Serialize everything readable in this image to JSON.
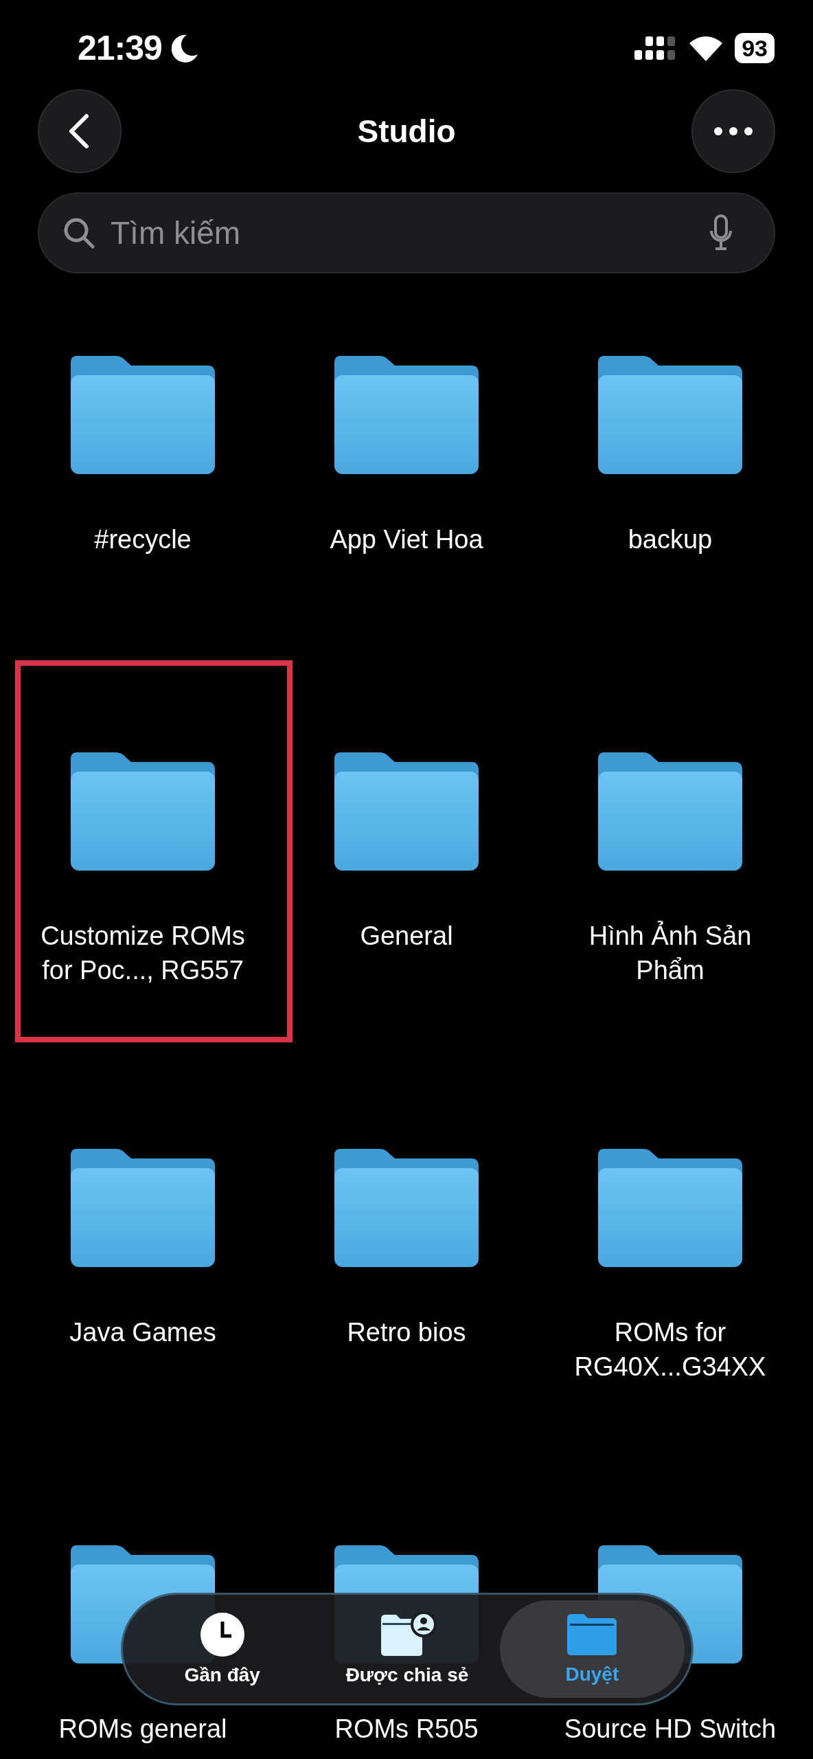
{
  "status_bar": {
    "time": "21:39",
    "battery": "93"
  },
  "header": {
    "title": "Studio"
  },
  "search": {
    "placeholder": "Tìm kiếm"
  },
  "folders": [
    {
      "name": "#recycle",
      "highlighted": false
    },
    {
      "name": "App Viet Hoa",
      "highlighted": false
    },
    {
      "name": "backup",
      "highlighted": false
    },
    {
      "name": "Customize ROMs for Poc..., RG557",
      "highlighted": true
    },
    {
      "name": "General",
      "highlighted": false
    },
    {
      "name": "Hình Ảnh Sản Phẩm",
      "highlighted": false
    },
    {
      "name": "Java Games",
      "highlighted": false
    },
    {
      "name": "Retro bios",
      "highlighted": false
    },
    {
      "name": "ROMs for RG40X...G34XX",
      "highlighted": false
    },
    {
      "name": "ROMs general",
      "highlighted": false
    },
    {
      "name": "ROMs R505",
      "highlighted": false
    },
    {
      "name": "Source HD Switch",
      "highlighted": false
    }
  ],
  "tab_bar": [
    {
      "label": "Gần đây",
      "kind": "recent",
      "selected": false
    },
    {
      "label": "Được chia sẻ",
      "kind": "shared",
      "selected": false
    },
    {
      "label": "Duyệt",
      "kind": "browse",
      "selected": true
    }
  ]
}
